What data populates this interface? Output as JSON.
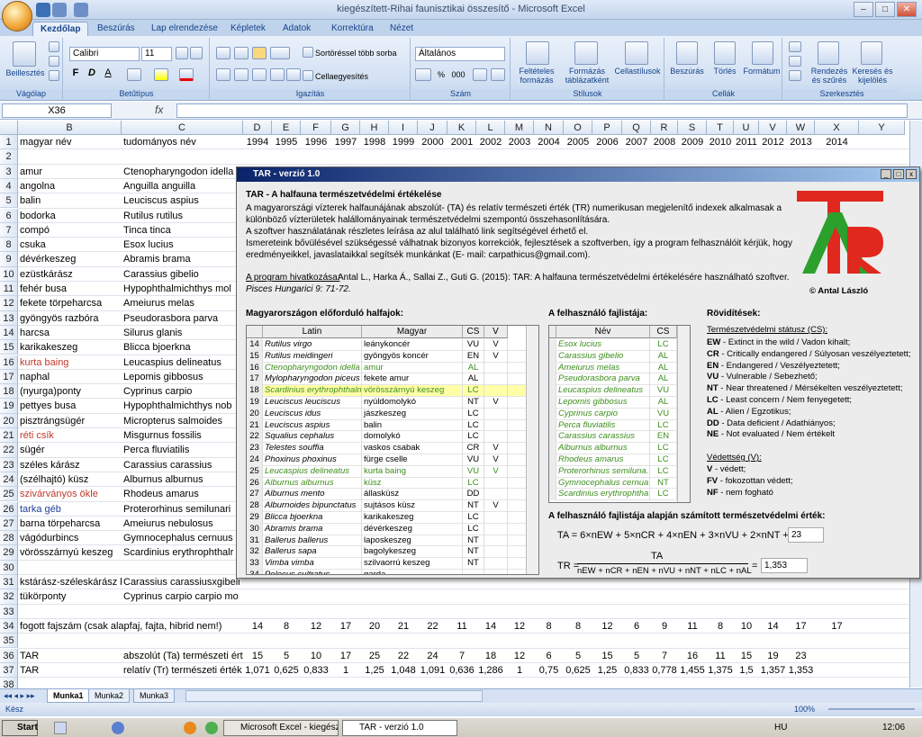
{
  "window": {
    "title": "kiegészített-Rihai faunisztikai összesítő - Microsoft Excel"
  },
  "ribbon": {
    "tabs": [
      "Kezdőlap",
      "Beszúrás",
      "Lap elrendezése",
      "Képletek",
      "Adatok",
      "Korrektúra",
      "Nézet"
    ],
    "groups": [
      "Vágólap",
      "Betűtípus",
      "Igazítás",
      "Szám",
      "Stílusok",
      "Cellák",
      "Szerkesztés"
    ],
    "paste": "Beillesztés",
    "font": "Calibri",
    "size": "11",
    "sort_many": "Sortöréssel több sorba",
    "merge": "Cellaegyesítés",
    "numfmt": "Általános",
    "cond": "Feltételes formázás",
    "table": "Formázás táblázatként",
    "cellstyles": "Cellastílusok",
    "insert": "Beszúrás",
    "delete": "Törlés",
    "format": "Formátum",
    "sortfilter": "Rendezés és szűrés",
    "findsel": "Keresés és kijelölés",
    "bold": "F",
    "italic": "D",
    "under": "A",
    "pct": "%",
    "thou": "000"
  },
  "formula": {
    "namebox": "X36",
    "fx": "fx"
  },
  "grid": {
    "cols": [
      {
        "l": "",
        "w": 20
      },
      {
        "l": "B",
        "w": 115
      },
      {
        "l": "C",
        "w": 135
      },
      {
        "l": "D",
        "w": 32
      },
      {
        "l": "E",
        "w": 32
      },
      {
        "l": "F",
        "w": 34
      },
      {
        "l": "G",
        "w": 32
      },
      {
        "l": "H",
        "w": 32
      },
      {
        "l": "I",
        "w": 32
      },
      {
        "l": "J",
        "w": 33
      },
      {
        "l": "K",
        "w": 32
      },
      {
        "l": "L",
        "w": 32
      },
      {
        "l": "M",
        "w": 32
      },
      {
        "l": "N",
        "w": 33
      },
      {
        "l": "O",
        "w": 32
      },
      {
        "l": "P",
        "w": 33
      },
      {
        "l": "Q",
        "w": 32
      },
      {
        "l": "R",
        "w": 30
      },
      {
        "l": "S",
        "w": 32
      },
      {
        "l": "T",
        "w": 30
      },
      {
        "l": "U",
        "w": 28
      },
      {
        "l": "V",
        "w": 31
      },
      {
        "l": "W",
        "w": 31
      },
      {
        "l": "X",
        "w": 49
      },
      {
        "l": "Y",
        "w": 51
      }
    ],
    "rows": [
      {
        "n": "1",
        "b": "magyar név",
        "c": "tudományos név",
        "v": [
          "1994",
          "1995",
          "1996",
          "1997",
          "1998",
          "1999",
          "2000",
          "2001",
          "2002",
          "2003",
          "2004",
          "2005",
          "2006",
          "2007",
          "2008",
          "2009",
          "2010",
          "2011",
          "2012",
          "2013",
          "2014"
        ]
      },
      {
        "n": "2"
      },
      {
        "n": "3",
        "b": "amur",
        "c": "Ctenopharyngodon idella"
      },
      {
        "n": "4",
        "b": "angolna",
        "c": "Anguilla anguilla"
      },
      {
        "n": "5",
        "b": "balin",
        "c": "Leuciscus aspius"
      },
      {
        "n": "6",
        "b": "bodorka",
        "c": "Rutilus rutilus"
      },
      {
        "n": "7",
        "b": "compó",
        "c": "Tinca tinca"
      },
      {
        "n": "8",
        "b": "csuka",
        "c": "Esox lucius"
      },
      {
        "n": "9",
        "b": "dévérkeszeg",
        "c": "Abramis brama"
      },
      {
        "n": "10",
        "b": "ezüstkárász",
        "c": "Carassius gibelio"
      },
      {
        "n": "11",
        "b": "fehér busa",
        "c": "Hypophthalmichthys mol"
      },
      {
        "n": "12",
        "b": "fekete törpeharcsa",
        "c": "Ameiurus melas"
      },
      {
        "n": "13",
        "b": "gyöngyös razbóra",
        "c": "Pseudorasbora parva"
      },
      {
        "n": "14",
        "b": "harcsa",
        "c": "Silurus glanis"
      },
      {
        "n": "15",
        "b": "karikakeszeg",
        "c": "Blicca bjoerkna"
      },
      {
        "n": "16",
        "b": "kurta baing",
        "c": "Leucaspius delineatus",
        "col": "red"
      },
      {
        "n": "17",
        "b": "naphal",
        "c": "Lepomis gibbosus"
      },
      {
        "n": "18",
        "b": "(nyurga)ponty",
        "c": "Cyprinus carpio"
      },
      {
        "n": "19",
        "b": "pettyes busa",
        "c": "Hypophthalmichthys nob"
      },
      {
        "n": "20",
        "b": "pisztrángsügér",
        "c": "Micropterus salmoides"
      },
      {
        "n": "21",
        "b": "réti csík",
        "c": "Misgurnus fossilis",
        "col": "red"
      },
      {
        "n": "22",
        "b": "sügér",
        "c": "Perca fluviatilis"
      },
      {
        "n": "23",
        "b": "széles kárász",
        "c": "Carassius carassius"
      },
      {
        "n": "24",
        "b": "(szélhajtó) küsz",
        "c": "Alburnus alburnus"
      },
      {
        "n": "25",
        "b": "szivárványos ökle",
        "c": "Rhodeus amarus",
        "col": "red"
      },
      {
        "n": "26",
        "b": "tarka géb",
        "c": "Proterorhinus semilunari",
        "col": "blue"
      },
      {
        "n": "27",
        "b": "barna törpeharcsa",
        "c": "Ameiurus nebulosus"
      },
      {
        "n": "28",
        "b": "vágódurbincs",
        "c": "Gymnocephalus cernuus"
      },
      {
        "n": "29",
        "b": "vörösszárnyú keszeg",
        "c": "Scardinius erythrophthalr"
      },
      {
        "n": "30"
      },
      {
        "n": "31",
        "b": "kstárász-széleskárász hi",
        "c": "Carassius carassiusxgibeli"
      },
      {
        "n": "32",
        "b": "tükörponty",
        "c": "Cyprinus carpio carpio mo"
      },
      {
        "n": "33"
      },
      {
        "n": "34",
        "b": "fogott fajszám (csak alapfaj, fajta, hibrid nem!)",
        "v": [
          "14",
          "8",
          "12",
          "17",
          "20",
          "21",
          "22",
          "11",
          "14",
          "12",
          "8",
          "8",
          "12",
          "6",
          "9",
          "11",
          "8",
          "10",
          "14",
          "17",
          "17"
        ]
      },
      {
        "n": "35"
      },
      {
        "n": "36",
        "b": "TAR",
        "c": "abszolút (Ta) természeti ért",
        "v": [
          "15",
          "5",
          "10",
          "17",
          "25",
          "22",
          "24",
          "7",
          "18",
          "12",
          "6",
          "5",
          "15",
          "5",
          "7",
          "16",
          "11",
          "15",
          "19",
          "23",
          ""
        ]
      },
      {
        "n": "37",
        "b": "TAR",
        "c": "relatív (Tr) természeti érték",
        "v": [
          "1,071",
          "0,625",
          "0,833",
          "1",
          "1,25",
          "1,048",
          "1,091",
          "0,636",
          "1,286",
          "1",
          "0,75",
          "0,625",
          "1,25",
          "0,833",
          "0,778",
          "1,455",
          "1,375",
          "1,5",
          "1,357",
          "1,353",
          ""
        ]
      },
      {
        "n": "38"
      }
    ]
  },
  "sheets": [
    "Munka1",
    "Munka2",
    "Munka3"
  ],
  "status": {
    "left": "Kész",
    "zoom": "100%"
  },
  "taskbar": {
    "start": "Start",
    "task1": "Microsoft Excel - kiegészí...",
    "task2": "TAR - verzió 1.0",
    "lang": "HU",
    "time": "12:06"
  },
  "dialog": {
    "title": "TAR - verzió 1.0",
    "heading": "TAR - A halfauna természetvédelmi értékelése",
    "para": [
      "A magyarországi vízterek halfaunájának abszolút- (TA) és relatív természeti érték (TR) numerikusan megjelenítő indexek alkalmasak a",
      "különböző vízterületek halállományainak természetvédelmi szempontú összehasonlítására.",
      "A szoftver használatának részletes leírása az alul található link segítségével érhető el.",
      "Ismereteink bővülésével szükségessé válhatnak bizonyos korrekciók, fejlesztések a szoftverben, így a program felhasználóit kérjük, hogy",
      "eredményeikkel, javaslataikkal segítsék munkánkat (E- mail: carpathicus@gmail.com)."
    ],
    "cite_label": "A program hivatkozása:",
    "cite": " Antal L., Harka Á., Sallai Z., Guti G. (2015): TAR: A halfauna természetvédelmi értékelésére használható szoftver.",
    "cite2": "Pisces Hungarici 9: 71-72.",
    "logo": "TAR",
    "copyright": "© Antal László",
    "left_title": "Magyarországon előforduló halfajok:",
    "left_headers": [
      "Latin",
      "Magyar",
      "CS",
      "V"
    ],
    "left_rows": [
      [
        "14",
        "Rutilus virgo",
        "leánykoncér",
        "VU",
        "V",
        ""
      ],
      [
        "15",
        "Rutilus meidingeri",
        "gyöngyös koncér",
        "EN",
        "V",
        ""
      ],
      [
        "16",
        "Ctenopharyngodon idella",
        "amur",
        "AL",
        "",
        "g"
      ],
      [
        "17",
        "Mylopharyngodon piceus",
        "fekete amur",
        "AL",
        "",
        ""
      ],
      [
        "18",
        "Scardinius erythrophthalmus",
        "vörösszárnyú keszeg",
        "LC",
        "",
        "gs"
      ],
      [
        "19",
        "Leuciscus leuciscus",
        "nyúldomolykó",
        "NT",
        "V",
        ""
      ],
      [
        "20",
        "Leuciscus idus",
        "jászkeszeg",
        "LC",
        "",
        ""
      ],
      [
        "21",
        "Leuciscus aspius",
        "balin",
        "LC",
        "",
        ""
      ],
      [
        "22",
        "Squalius cephalus",
        "domolykó",
        "LC",
        "",
        ""
      ],
      [
        "23",
        "Telestes souffia",
        "vaskos csabak",
        "CR",
        "V",
        ""
      ],
      [
        "24",
        "Phoxinus phoxinus",
        "fürge cselle",
        "VU",
        "V",
        ""
      ],
      [
        "25",
        "Leucaspius delineatus",
        "kurta baing",
        "VU",
        "V",
        "g"
      ],
      [
        "26",
        "Alburnus alburnus",
        "küsz",
        "LC",
        "",
        "g"
      ],
      [
        "27",
        "Alburnus mento",
        "állasküsz",
        "DD",
        "",
        ""
      ],
      [
        "28",
        "Alburnoides bipunctatus",
        "sujtásos küsz",
        "NT",
        "V",
        ""
      ],
      [
        "29",
        "Blicca bjoerkna",
        "karikakeszeg",
        "LC",
        "",
        ""
      ],
      [
        "30",
        "Abramis brama",
        "dévérkeszeg",
        "LC",
        "",
        ""
      ],
      [
        "31",
        "Ballerus ballerus",
        "laposkeszeg",
        "NT",
        "",
        ""
      ],
      [
        "32",
        "Ballerus sapa",
        "bagolykeszeg",
        "NT",
        "",
        ""
      ],
      [
        "33",
        "Vimba vimba",
        "szilvaorrú keszeg",
        "NT",
        "",
        ""
      ],
      [
        "34",
        "Pelecus cultratus",
        "garda",
        "",
        "",
        ""
      ]
    ],
    "right_title": "A felhasználó fajlistája:",
    "right_headers": [
      "Név",
      "CS"
    ],
    "right_rows": [
      [
        "Esox lucius",
        "LC"
      ],
      [
        "Carassius gibelio",
        "AL"
      ],
      [
        "Ameiurus melas",
        "AL"
      ],
      [
        "Pseudorasbora parva",
        "AL"
      ],
      [
        "Leucaspius delineatus",
        "VU"
      ],
      [
        "Lepomis gibbosus",
        "AL"
      ],
      [
        "Cyprinus carpio",
        "VU"
      ],
      [
        "Perca fluviatilis",
        "LC"
      ],
      [
        "Carassius carassius",
        "EN"
      ],
      [
        "Alburnus alburnus",
        "LC"
      ],
      [
        "Rhodeus amarus",
        "LC"
      ],
      [
        "Proterorhinus semiluna...",
        "LC"
      ],
      [
        "Gymnocephalus cernua",
        "NT"
      ],
      [
        "Scardinius erythrophtha...",
        "LC"
      ]
    ],
    "abbr_title": "Rövidítések:",
    "status_title": "Természetvédelmi státusz (CS):",
    "abbr": [
      [
        "EW",
        "Extinct in the wild / Vadon kihalt;"
      ],
      [
        "CR",
        "Critically endangered / Súlyosan veszélyeztetett;"
      ],
      [
        "EN",
        "Endangered / Veszélyeztetett;"
      ],
      [
        "VU",
        "Vulnerable / Sebezhető;"
      ],
      [
        "NT",
        "Near threatened / Mérsékelten veszélyeztetett;"
      ],
      [
        "LC",
        "Least concern / Nem fenyegetett;"
      ],
      [
        "AL",
        "Alien / Egzotikus;"
      ],
      [
        "DD",
        "Data deficient / Adathiányos;"
      ],
      [
        "NE",
        "Not evaluated / Nem értékelt"
      ]
    ],
    "prot_title": "Védettség (V):",
    "prot": [
      [
        "V",
        "védett;"
      ],
      [
        "FV",
        "fokozottan védett;"
      ],
      [
        "NF",
        "nem fogható"
      ]
    ],
    "calc_title": "A felhasználó fajlistája alapján számított természetvédelmi érték:",
    "ta_formula": "TA = 6×nEW + 5×nCR + 4×nEN + 3×nVU + 2×nNT + nLC =",
    "ta_value": "23",
    "tr_lhs": "TR =",
    "tr_num": "TA",
    "tr_den": "nEW + nCR + nEN + nVU + nNT + nLC + nAL",
    "tr_eq": "=",
    "tr_value": "1,353"
  }
}
